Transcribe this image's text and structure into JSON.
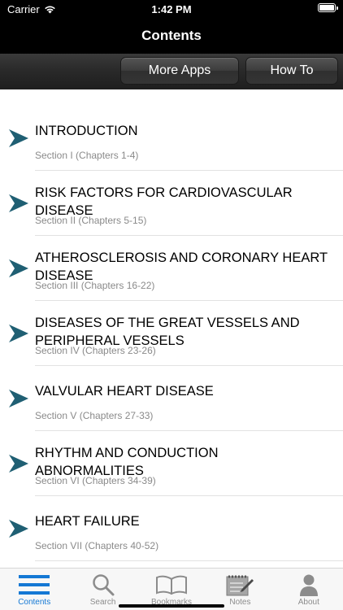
{
  "status_bar": {
    "carrier": "Carrier",
    "time": "1:42 PM"
  },
  "nav": {
    "title": "Contents"
  },
  "toolbar": {
    "more_apps_label": "More Apps",
    "how_to_label": "How To"
  },
  "colors": {
    "accent": "#1478d4",
    "arrow": "#1f5f73",
    "subtitle": "#8a8a8a"
  },
  "sections": [
    {
      "title": "INTRODUCTION",
      "subtitle": "Section I (Chapters 1-4)"
    },
    {
      "title": "RISK FACTORS FOR CARDIOVASCULAR DISEASE",
      "subtitle": "Section II (Chapters 5-15)"
    },
    {
      "title": "ATHEROSCLEROSIS AND CORONARY HEART DISEASE",
      "subtitle": "Section III (Chapters 16-22)"
    },
    {
      "title": "DISEASES OF THE GREAT VESSELS AND PERIPHERAL VESSELS",
      "subtitle": "Section IV (Chapters 23-26)"
    },
    {
      "title": "VALVULAR HEART DISEASE",
      "subtitle": "Section V (Chapters 27-33)"
    },
    {
      "title": "RHYTHM AND CONDUCTION ABNORMALITIES",
      "subtitle": "Section VI (Chapters 34-39)"
    },
    {
      "title": "HEART FAILURE",
      "subtitle": "Section VII (Chapters 40-52)"
    }
  ],
  "tabs": [
    {
      "label": "Contents",
      "icon": "list-icon",
      "active": true
    },
    {
      "label": "Search",
      "icon": "search-icon",
      "active": false
    },
    {
      "label": "Bookmarks",
      "icon": "book-icon",
      "active": false
    },
    {
      "label": "Notes",
      "icon": "notepad-pencil-icon",
      "active": false
    },
    {
      "label": "About",
      "icon": "person-icon",
      "active": false
    }
  ]
}
